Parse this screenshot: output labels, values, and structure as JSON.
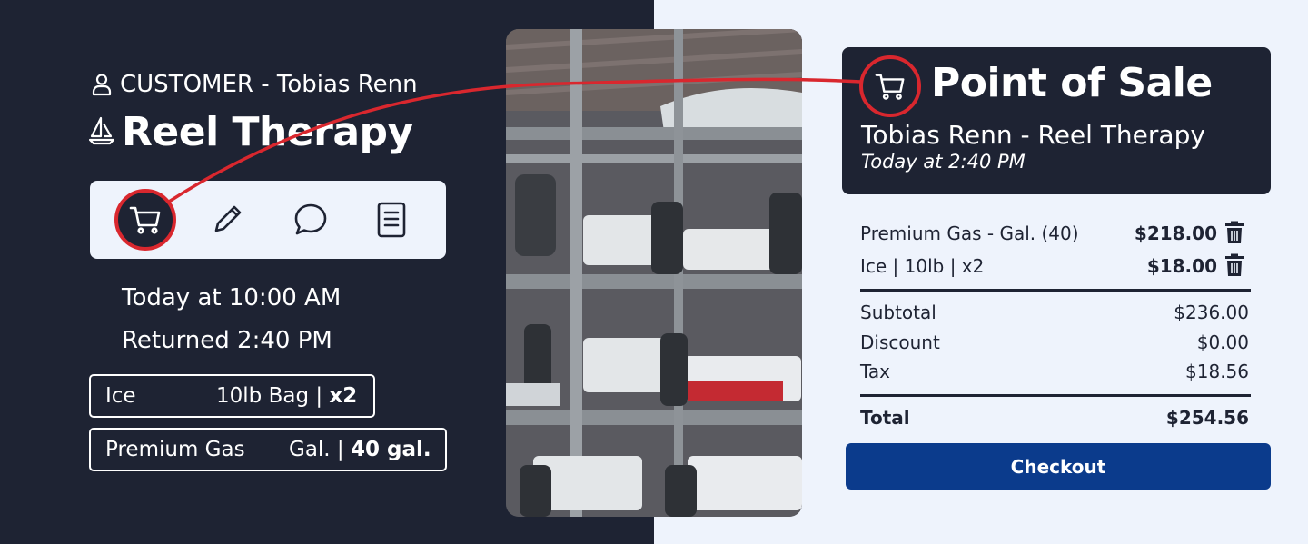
{
  "colors": {
    "dark_navy": "#1e2333",
    "light_bg": "#eef3fc",
    "accent_red": "#d9272e",
    "checkout_blue": "#0b3b8c"
  },
  "customer": {
    "icon": "person-icon",
    "label": "CUSTOMER - Tobias Renn",
    "boat_icon": "sailboat-icon",
    "boat_name": "Reel Therapy"
  },
  "actions": [
    {
      "name": "cart",
      "icon": "cart-icon"
    },
    {
      "name": "edit",
      "icon": "pencil-icon"
    },
    {
      "name": "message",
      "icon": "chat-bubble-icon"
    },
    {
      "name": "document",
      "icon": "document-icon"
    }
  ],
  "schedule": {
    "departed": "Today at 10:00 AM",
    "returned": "Returned 2:40 PM"
  },
  "requests": {
    "ice": {
      "name": "Ice",
      "unit": "10lb Bag | ",
      "qty": "x2"
    },
    "gas": {
      "name": "Premium Gas",
      "unit": "Gal. | ",
      "qty": "40 gal."
    }
  },
  "photo": {
    "description_icon": "boat-storage-rack-photo"
  },
  "pos": {
    "title": "Point of Sale",
    "subtitle": "Tobias Renn - Reel Therapy",
    "time": "Today at 2:40 PM",
    "line_items": [
      {
        "desc": "Premium Gas - Gal. (40)",
        "amount": "$218.00"
      },
      {
        "desc": "Ice | 10lb | x2",
        "amount": "$18.00"
      }
    ],
    "summary": {
      "subtotal_label": "Subtotal",
      "subtotal": "$236.00",
      "discount_label": "Discount",
      "discount": "$0.00",
      "tax_label": "Tax",
      "tax": "$18.56",
      "total_label": "Total",
      "total": "$254.56"
    },
    "checkout_label": "Checkout"
  }
}
